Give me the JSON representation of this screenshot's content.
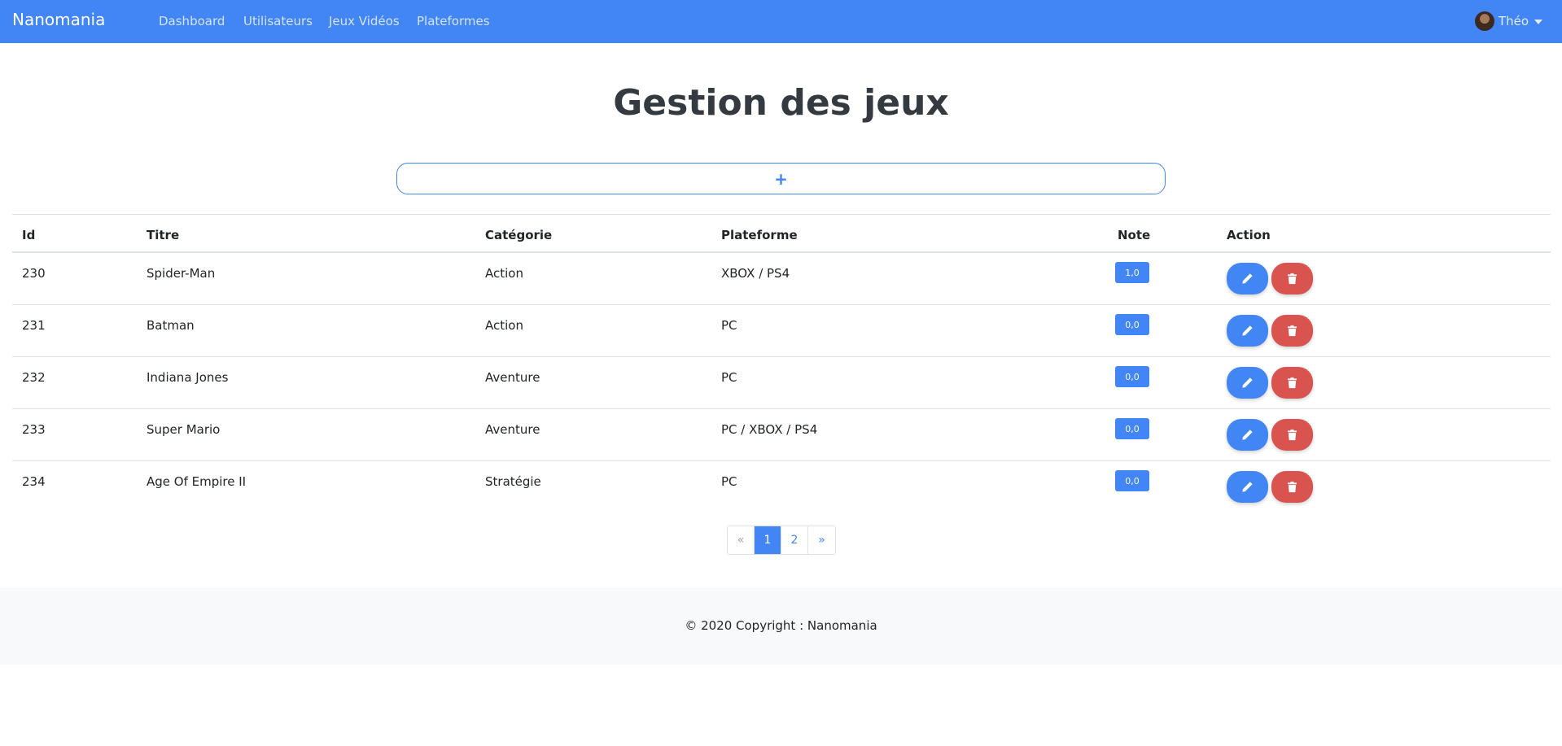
{
  "navbar": {
    "brand": "Nanomania",
    "links": [
      "Dashboard",
      "Utilisateurs",
      "Jeux Vidéos",
      "Plateformes"
    ],
    "user_name": "Théo",
    "color": "#4285f4"
  },
  "page": {
    "title": "Gestion des jeux",
    "add_label": "+"
  },
  "table": {
    "headers": {
      "id": "Id",
      "title": "Titre",
      "category": "Catégorie",
      "platform": "Plateforme",
      "rating": "Note",
      "action": "Action"
    },
    "rows": [
      {
        "id": "230",
        "title": "Spider-Man",
        "category": "Action",
        "platform": "XBOX / PS4",
        "rating": "1,0"
      },
      {
        "id": "231",
        "title": "Batman",
        "category": "Action",
        "platform": "PC",
        "rating": "0,0"
      },
      {
        "id": "232",
        "title": "Indiana Jones",
        "category": "Aventure",
        "platform": "PC",
        "rating": "0,0"
      },
      {
        "id": "233",
        "title": "Super Mario",
        "category": "Aventure",
        "platform": "PC / XBOX / PS4",
        "rating": "0,0"
      },
      {
        "id": "234",
        "title": "Age Of Empire II",
        "category": "Stratégie",
        "platform": "PC",
        "rating": "0,0"
      }
    ],
    "edit_icon": "pencil-icon",
    "delete_icon": "trash-icon",
    "edit_color": "#4285f4",
    "delete_color": "#d9534f"
  },
  "pagination": {
    "prev": "«",
    "pages": [
      "1",
      "2"
    ],
    "next": "»",
    "active_page": "1"
  },
  "footer": {
    "text": "© 2020 Copyright : Nanomania"
  }
}
